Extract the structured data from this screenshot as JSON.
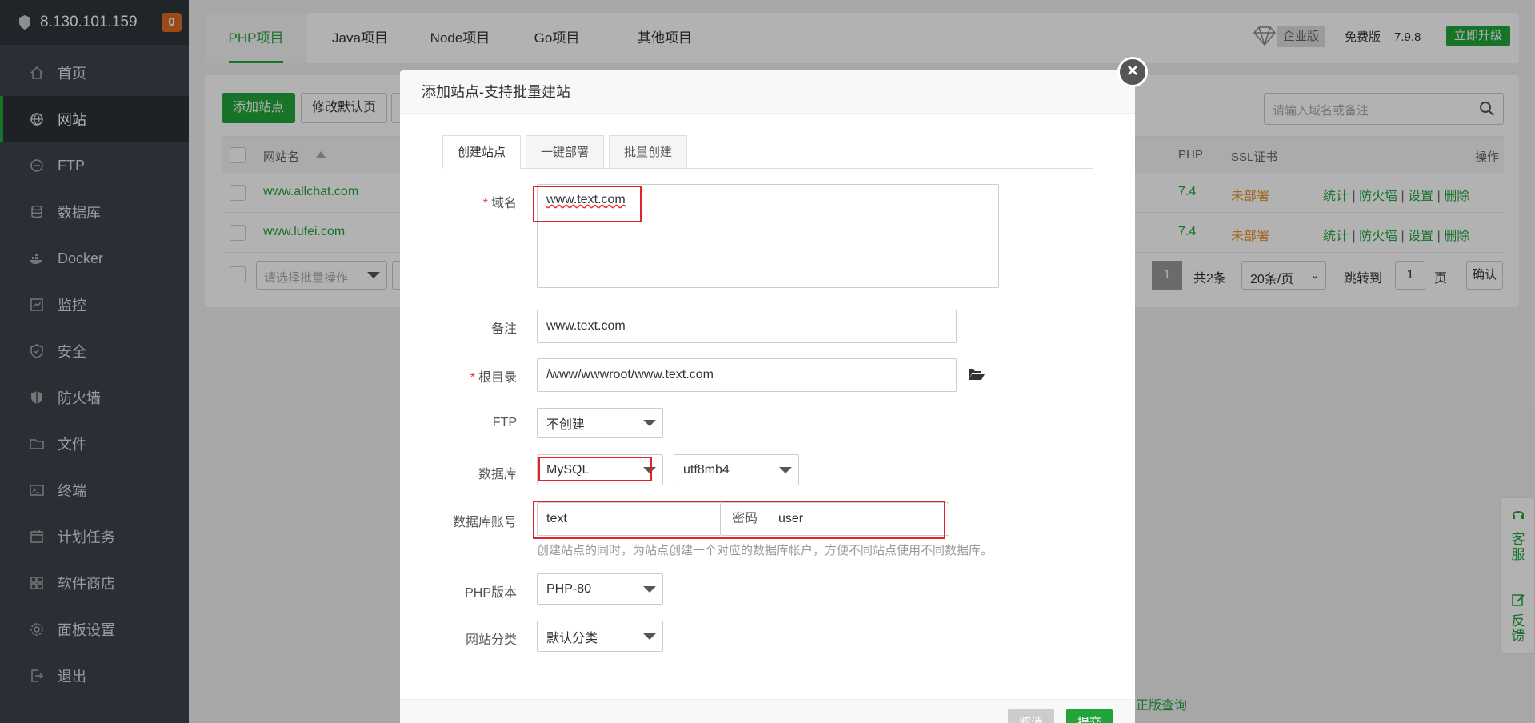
{
  "sidebar": {
    "server_ip": "8.130.101.159",
    "badge": "0",
    "items": [
      {
        "label": "首页",
        "icon": "home-icon"
      },
      {
        "label": "网站",
        "icon": "globe-icon"
      },
      {
        "label": "FTP",
        "icon": "ftp-icon"
      },
      {
        "label": "数据库",
        "icon": "database-icon"
      },
      {
        "label": "Docker",
        "icon": "docker-icon"
      },
      {
        "label": "监控",
        "icon": "monitor-icon"
      },
      {
        "label": "安全",
        "icon": "shield-icon"
      },
      {
        "label": "防火墙",
        "icon": "firewall-icon"
      },
      {
        "label": "文件",
        "icon": "folder-icon"
      },
      {
        "label": "终端",
        "icon": "terminal-icon"
      },
      {
        "label": "计划任务",
        "icon": "calendar-icon"
      },
      {
        "label": "软件商店",
        "icon": "apps-icon"
      },
      {
        "label": "面板设置",
        "icon": "gear-icon"
      },
      {
        "label": "退出",
        "icon": "logout-icon"
      }
    ]
  },
  "topbar": {
    "tabs": [
      "PHP项目",
      "Java项目",
      "Node项目",
      "Go项目",
      "其他项目"
    ],
    "enterprise": "企业版",
    "free_version": "免费版",
    "version": "7.9.8",
    "upgrade": "立即升级"
  },
  "panel": {
    "add_site": "添加站点",
    "modify_default": "修改默认页",
    "search_placeholder": "请输入域名或备注",
    "columns": {
      "name": "网站名",
      "php": "PHP",
      "ssl": "SSL证书",
      "ops": "操作"
    },
    "rows": [
      {
        "name": "www.allchat.com",
        "php": "7.4",
        "ssl": "未部署"
      },
      {
        "name": "www.lufei.com",
        "php": "7.4",
        "ssl": "未部署"
      }
    ],
    "ops": [
      "统计",
      "防火墙",
      "设置",
      "删除"
    ],
    "batch_placeholder": "请选择批量操作",
    "pagination": {
      "page": "1",
      "total": "共2条",
      "per_page": "20条/页",
      "jump": "跳转到",
      "jump_value": "1",
      "page_unit": "页",
      "confirm": "确认"
    }
  },
  "footer": {
    "genuine": "正版查询"
  },
  "side_float": {
    "service": "客服",
    "feedback": "反馈"
  },
  "modal": {
    "title": "添加站点-支持批量建站",
    "tabs": [
      "创建站点",
      "一键部署",
      "批量创建"
    ],
    "fields": {
      "domain_label": "域名",
      "domain_value": "www.text.com",
      "remark_label": "备注",
      "remark_value": "www.text.com",
      "root_label": "根目录",
      "root_value": "/www/wwwroot/www.text.com",
      "ftp_label": "FTP",
      "ftp_value": "不创建",
      "db_label": "数据库",
      "db_value": "MySQL",
      "charset_value": "utf8mb4",
      "db_account_label": "数据库账号",
      "db_account_value": "text",
      "password_label": "密码",
      "password_value": "user",
      "db_hint": "创建站点的同时，为站点创建一个对应的数据库帐户，方便不同站点使用不同数据库。",
      "php_label": "PHP版本",
      "php_value": "PHP-80",
      "category_label": "网站分类",
      "category_value": "默认分类"
    },
    "cancel": "取消",
    "submit": "提交"
  }
}
